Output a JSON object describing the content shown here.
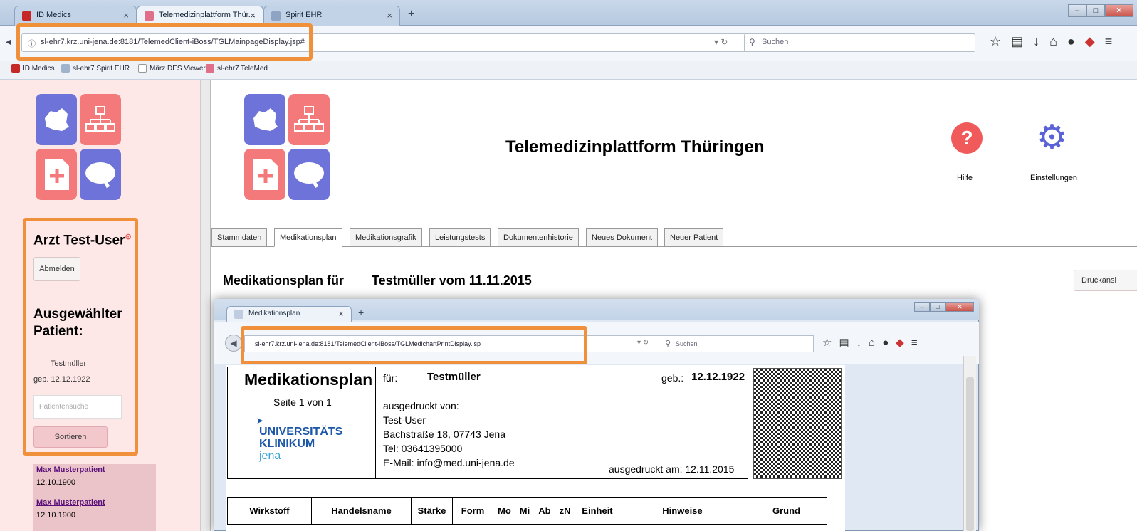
{
  "browser": {
    "tabs": [
      {
        "label": "ID Medics",
        "color": "#c62828"
      },
      {
        "label": "Telemedizinplattform Thür...",
        "color": "#e0708a"
      },
      {
        "label": "Spirit EHR",
        "color": "#8fa4c2"
      }
    ],
    "url": "sl-ehr7.krz.uni-jena.de:8181/TelemedClient-iBoss/TGLMainpageDisplay.jsp#",
    "search_placeholder": "Suchen",
    "bookmarks": [
      "ID Medics",
      "sl-ehr7 Spirit EHR",
      "März DES Viewer",
      "sl-ehr7 TeleMed"
    ]
  },
  "sidebar": {
    "user": "Arzt Test-User",
    "logout": "Abmelden",
    "selected_heading": "Ausgewählter Patient:",
    "patient_name": "Testmüller",
    "patient_dob": "geb. 12.12.1922",
    "search_placeholder": "Patientensuche",
    "sort": "Sortieren",
    "patients": [
      {
        "name": "Max Musterpatient",
        "dob": "12.10.1900"
      },
      {
        "name": "Max Musterpatient",
        "dob": "12.10.1900"
      }
    ]
  },
  "header": {
    "title": "Telemedizinplattform Thüringen",
    "help": "Hilfe",
    "settings": "Einstellungen"
  },
  "tabs": [
    "Stammdaten",
    "Medikationsplan",
    "Medikationsgrafik",
    "Leistungstests",
    "Dokumentenhistorie",
    "Neues Dokument",
    "Neuer Patient"
  ],
  "content": {
    "plan_for": "Medikationsplan für",
    "patient_date": "Testmüller vom 11.11.2015",
    "print_view": "Druckansi"
  },
  "popup": {
    "tab": "Medikationsplan",
    "url": "sl-ehr7.krz.uni-jena.de:8181/TelemedClient-iBoss/TGLMedichartPrintDisplay.jsp",
    "search_placeholder": "Suchen",
    "doc": {
      "title": "Medikationsplan",
      "page": "Seite 1 von 1",
      "logo_line1": "UNIVERSITÄTS",
      "logo_line2": "KLINIKUM",
      "logo_line3": "jena",
      "for_label": "für:",
      "patient": "Testmüller",
      "dob_label": "geb.:",
      "dob": "12.12.1922",
      "printed_by_label": "ausgedruckt von:",
      "printed_by": "Test-User",
      "address": "Bachstraße 18, 07743 Jena",
      "tel": "Tel: 03641395000",
      "email": "E-Mail: info@med.uni-jena.de",
      "printed_on": "ausgedruckt am: 12.11.2015",
      "columns": [
        "Wirkstoff",
        "Handelsname",
        "Stärke",
        "Form",
        "Mo",
        "Mi",
        "Ab",
        "zN",
        "Einheit",
        "Hinweise",
        "Grund"
      ]
    }
  }
}
